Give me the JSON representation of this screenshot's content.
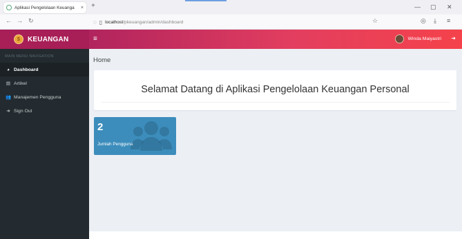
{
  "browser": {
    "tab_title": "Aplikasi Pengelolaan Keuanga",
    "tab_close": "×",
    "new_tab": "+",
    "url_host": "localhost",
    "url_path": "/pkeuangan/admin/dashboard",
    "controls": {
      "minimize": "—",
      "maximize": "▢",
      "close": "✕"
    }
  },
  "app": {
    "brand": "KEUANGAN",
    "user_name": "Winda Maiyastri"
  },
  "sidebar": {
    "header": "MAIN MENU NAVIGATION",
    "items": [
      {
        "label": "Dashboard",
        "icon": "dashboard-icon",
        "active": true
      },
      {
        "label": "Artikel",
        "icon": "article-icon",
        "active": false
      },
      {
        "label": "Manajemen Pengguna",
        "icon": "users-icon",
        "active": false
      },
      {
        "label": "Sign Out",
        "icon": "signout-icon",
        "active": false
      }
    ]
  },
  "main": {
    "page_title": "Home",
    "welcome": "Selamat Datang di Aplikasi Pengelolaan Keuangan Personal",
    "stat": {
      "value": "2",
      "label": "Jumlah Pengguna",
      "icon": "users-icon",
      "color": "#3c8dbc"
    }
  },
  "colors": {
    "brand_bg": "#a81e57",
    "topbar_start": "#b1245e",
    "topbar_end": "#f5424b",
    "sidebar_bg": "#232b30",
    "content_bg": "#ecf0f5"
  }
}
